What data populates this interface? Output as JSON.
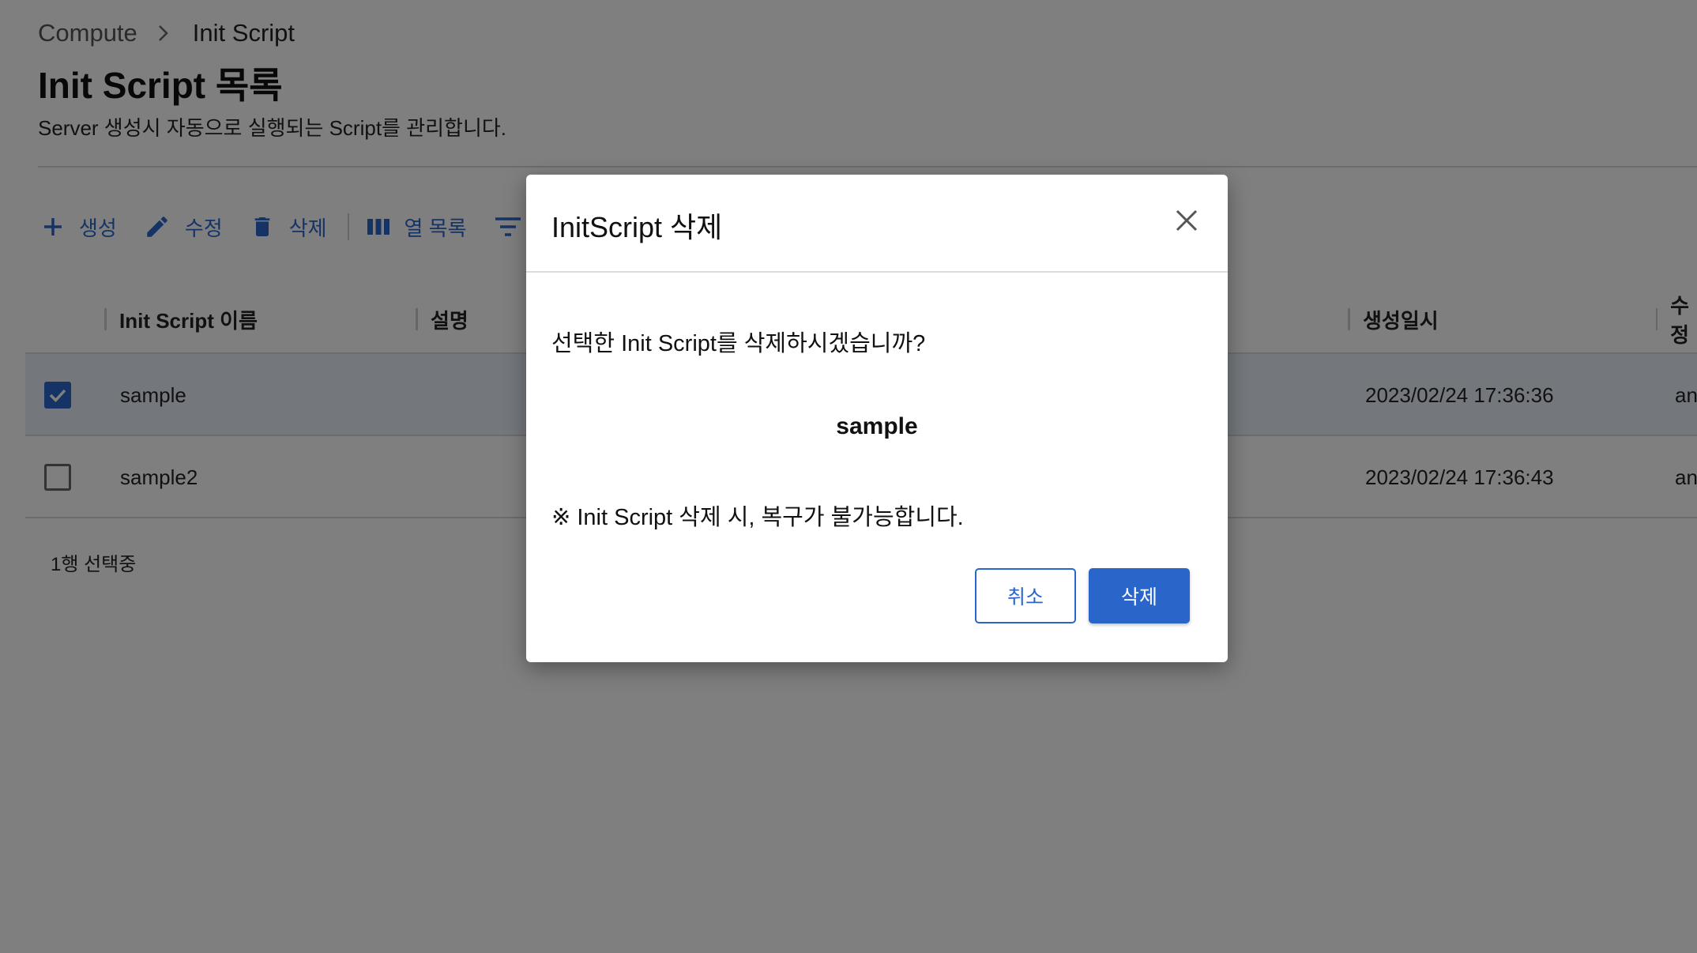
{
  "breadcrumb": {
    "parent": "Compute",
    "current": "Init Script"
  },
  "page": {
    "title": "Init Script 목록",
    "description": "Server 생성시 자동으로 실행되는 Script를 관리합니다."
  },
  "toolbar": {
    "create_label": "생성",
    "edit_label": "수정",
    "delete_label": "삭제",
    "columns_label": "열 목록"
  },
  "table": {
    "columns": [
      "Init Script 이름",
      "설명",
      "생성일시",
      "수정"
    ],
    "rows": [
      {
        "name": "sample",
        "created": "2023/02/24 17:36:36",
        "modified": "an",
        "selected": true
      },
      {
        "name": "sample2",
        "created": "2023/02/24 17:36:43",
        "modified": "an",
        "selected": false
      }
    ],
    "selection_status": "1행 선택중"
  },
  "dialog": {
    "title": "InitScript 삭제",
    "message": "선택한 Init Script를 삭제하시겠습니까?",
    "target": "sample",
    "warning": "※ Init Script 삭제 시, 복구가 불가능합니다.",
    "cancel_label": "취소",
    "confirm_label": "삭제"
  },
  "colors": {
    "accent": "#2a66c9",
    "overlay": "rgba(0,0,0,0.5)",
    "selected_row": "#e8f0fb"
  }
}
